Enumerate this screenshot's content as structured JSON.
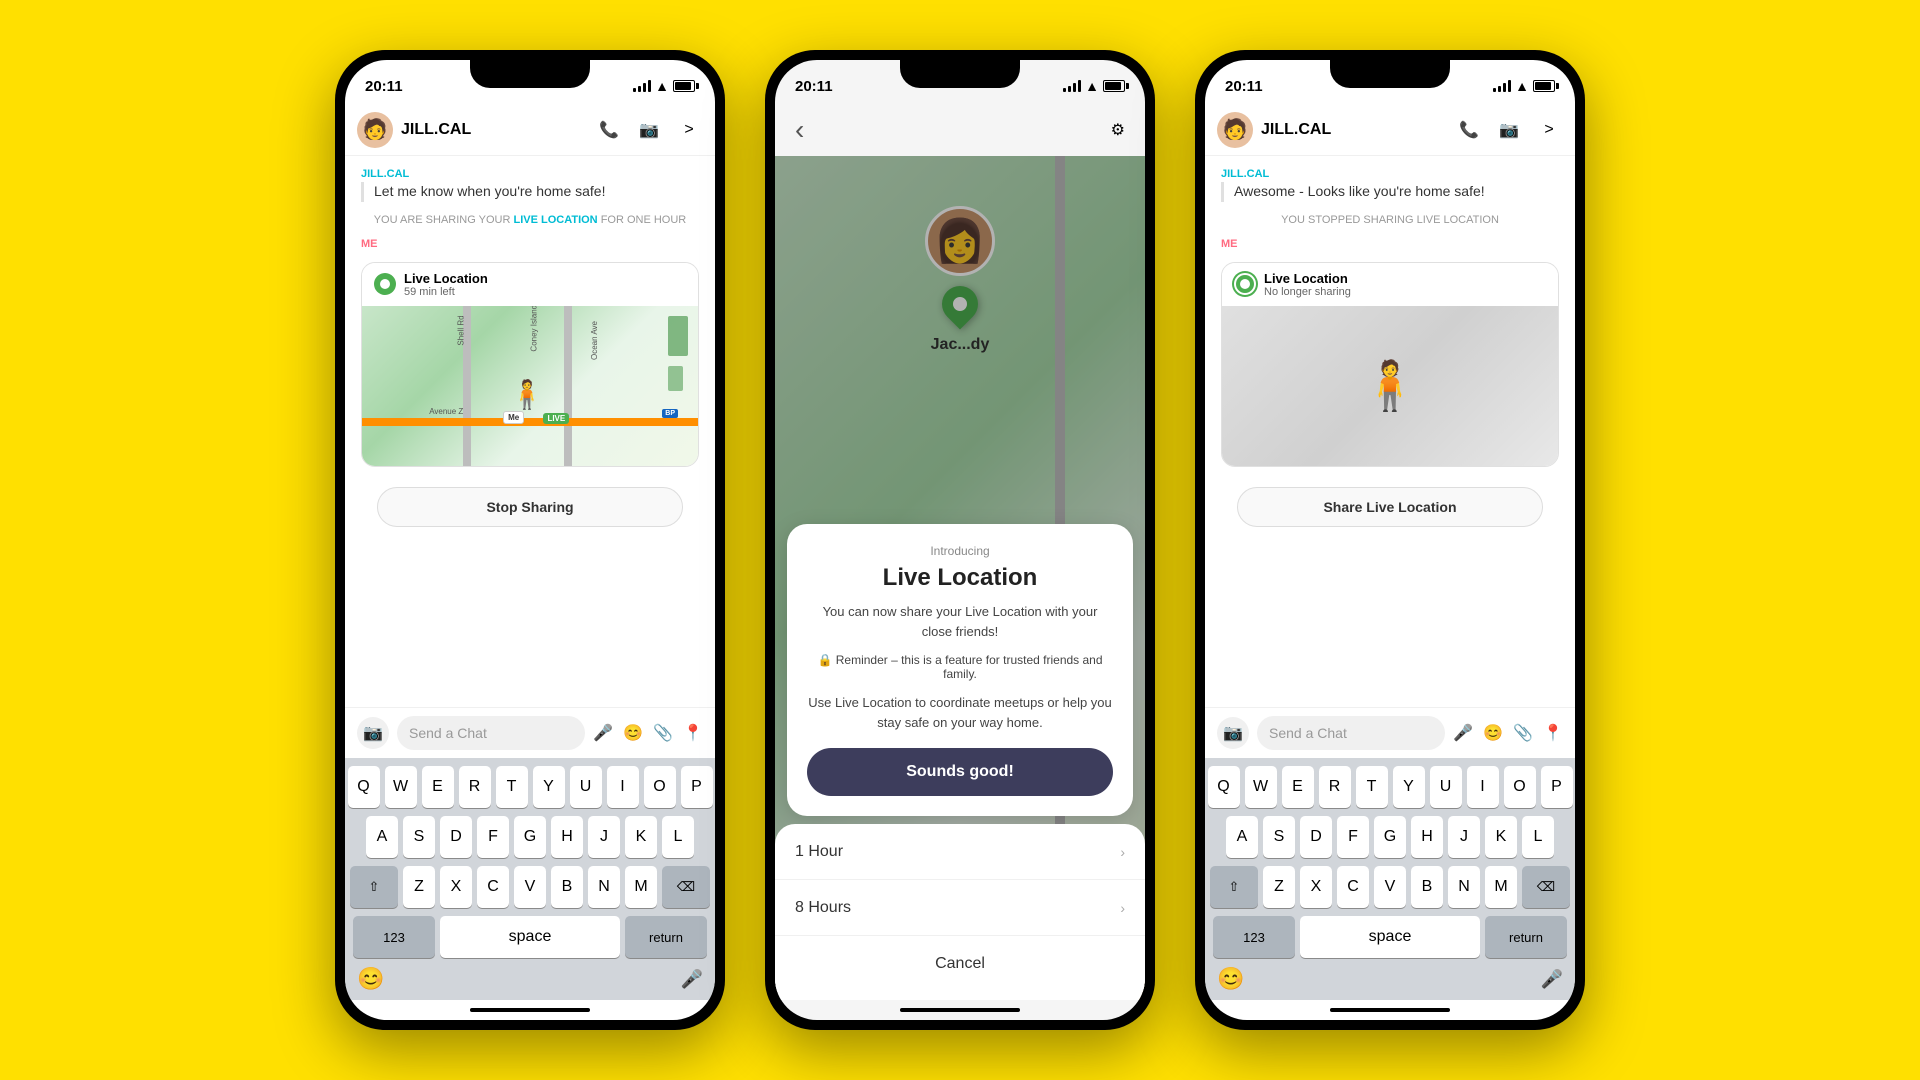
{
  "background_color": "#FFE000",
  "phones": [
    {
      "id": "left",
      "status_bar": {
        "time": "20:11",
        "signal": true,
        "wifi": true,
        "battery": true
      },
      "header": {
        "name": "JILL.CAL",
        "call_icon": "📞",
        "video_icon": "📷",
        "more_icon": ">"
      },
      "chat": {
        "sender_label": "JILL.CAL",
        "sender_color": "cyan",
        "message": "Let me know when you're home safe!",
        "system_message": "YOU ARE SHARING YOUR LIVE LOCATION FOR ONE HOUR",
        "live_link_text": "LIVE LOCATION",
        "me_label": "ME",
        "live_location": {
          "title": "Live Location",
          "subtitle": "59 min left",
          "map_labels": [
            "Shell Rd",
            "Ocean Ave",
            "Coney Island Ave",
            "Avenue Z"
          ],
          "bitmoji": "🧍",
          "live_badge": "LIVE",
          "me_badge": "Me",
          "bp_label": "BP"
        },
        "stop_btn": "Stop Sharing"
      },
      "input": {
        "placeholder": "Send a Chat",
        "camera_icon": "📷",
        "mic_icon": "🎤",
        "emoji_icon": "😊",
        "attach_icon": "📎",
        "location_icon": "📍"
      },
      "keyboard": {
        "rows": [
          [
            "Q",
            "W",
            "E",
            "R",
            "T",
            "Y",
            "U",
            "I",
            "O",
            "P"
          ],
          [
            "A",
            "S",
            "D",
            "F",
            "G",
            "H",
            "J",
            "K",
            "L"
          ],
          [
            "⇧",
            "Z",
            "X",
            "C",
            "V",
            "B",
            "N",
            "M",
            "⌫"
          ],
          [
            "123",
            "space",
            "return"
          ]
        ],
        "bottom": {
          "emoji": "😊",
          "mic": "🎤"
        }
      }
    },
    {
      "id": "middle",
      "status_bar": {
        "time": "20:11"
      },
      "snap": {
        "back_icon": "‹",
        "settings_icon": "⚙",
        "bitmoji": "👩",
        "name": "Jac...dy"
      },
      "modal": {
        "introducing": "Introducing",
        "title": "Live Location",
        "desc": "You can now share your Live Location with your close friends!",
        "reminder": "🔒 Reminder – this is a feature for trusted friends and family.",
        "use_text": "Use Live Location to coordinate meetups or help you stay safe on your way home.",
        "sounds_good_btn": "Sounds good!",
        "options": [
          {
            "label": "1 Hour",
            "arrow": "›"
          },
          {
            "label": "8 Hours",
            "arrow": "›"
          }
        ],
        "cancel_btn": "Cancel"
      }
    },
    {
      "id": "right",
      "status_bar": {
        "time": "20:11"
      },
      "header": {
        "name": "JILL.CAL",
        "call_icon": "📞",
        "video_icon": "📷",
        "more_icon": ">"
      },
      "chat": {
        "sender_label": "JILL.CAL",
        "sender_color": "cyan",
        "message": "Awesome - Looks like you're home safe!",
        "system_message": "YOU STOPPED SHARING LIVE LOCATION",
        "me_label": "ME",
        "live_location": {
          "title": "Live Location",
          "subtitle": "No longer sharing"
        },
        "share_btn": "Share Live Location"
      },
      "input": {
        "placeholder": "Send a Chat"
      },
      "keyboard": {
        "rows": [
          [
            "Q",
            "W",
            "E",
            "R",
            "T",
            "Y",
            "U",
            "I",
            "O",
            "P"
          ],
          [
            "A",
            "S",
            "D",
            "F",
            "G",
            "H",
            "J",
            "K",
            "L"
          ],
          [
            "⇧",
            "Z",
            "X",
            "C",
            "V",
            "B",
            "N",
            "M",
            "⌫"
          ],
          [
            "123",
            "space",
            "return"
          ]
        ]
      }
    }
  ]
}
